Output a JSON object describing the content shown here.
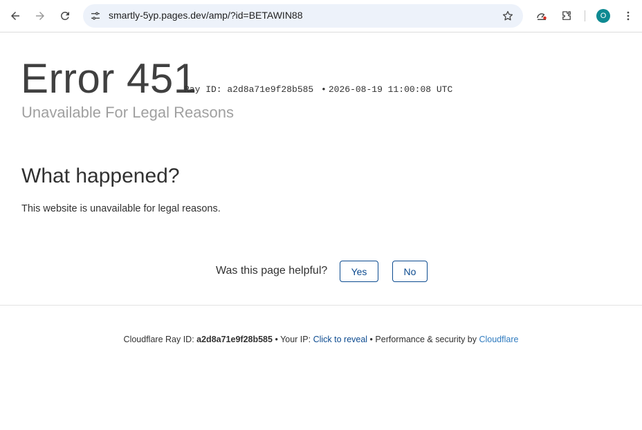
{
  "browser": {
    "url": "smartly-5yp.pages.dev/amp/?id=BETAWIN88",
    "profile_initial": "O",
    "avatar_color": "#0e8a92"
  },
  "error": {
    "code": "Error 451",
    "ray_label": "Ray ID: a2d8a71e9f28b585",
    "separator": "•",
    "timestamp": "2026-08-19 11:00:08 UTC",
    "subtitle": "Unavailable For Legal Reasons"
  },
  "what_happened": {
    "heading": "What happened?",
    "text": "This website is unavailable for legal reasons."
  },
  "feedback": {
    "question": "Was this page helpful?",
    "yes_label": "Yes",
    "no_label": "No"
  },
  "footer": {
    "ray_prefix": "Cloudflare Ray ID: ",
    "ray_id": "a2d8a71e9f28b585",
    "sep1": " • ",
    "ip_prefix": "Your IP: ",
    "ip_link": "Click to reveal",
    "sep2": " • ",
    "perf_text": "Performance & security by ",
    "cf_link": "Cloudflare",
    "link_color": "#0b4a8f"
  }
}
